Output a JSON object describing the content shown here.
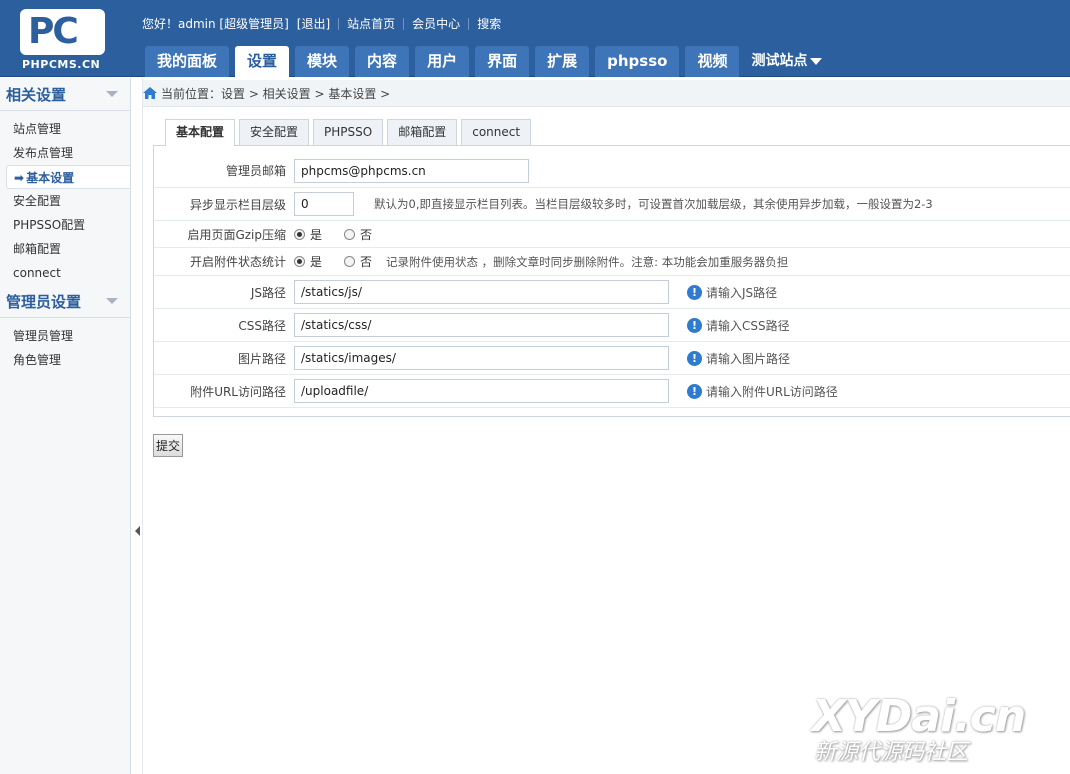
{
  "logo": {
    "mark": "PC",
    "text": "PHPCMS.CN"
  },
  "toplinks": {
    "greeting": "您好！admin [超级管理员]",
    "logout": "[退出]",
    "site_home": "站点首页",
    "member_center": "会员中心",
    "search": "搜索"
  },
  "nav": {
    "tabs": [
      "我的面板",
      "设置",
      "模块",
      "内容",
      "用户",
      "界面",
      "扩展",
      "phpsso",
      "视频"
    ],
    "active_index": 1,
    "site_selector": "测试站点"
  },
  "sidebar": {
    "group1": {
      "title": "相关设置",
      "items": [
        "站点管理",
        "发布点管理",
        "基本设置",
        "安全配置",
        "PHPSSO配置",
        "邮箱配置",
        "connect"
      ]
    },
    "group2": {
      "title": "管理员设置",
      "items": [
        "管理员管理",
        "角色管理"
      ]
    },
    "active_item": "基本设置"
  },
  "breadcrumb": "当前位置：设置 > 相关设置 > 基本设置 >",
  "subtabs": [
    "基本配置",
    "安全配置",
    "PHPSSO",
    "邮箱配置",
    "connect"
  ],
  "form": {
    "admin_email": {
      "label": "管理员邮箱",
      "value": "phpcms@phpcms.cn"
    },
    "category_level": {
      "label": "异步显示栏目层级",
      "value": "0",
      "hint": "默认为0,即直接显示栏目列表。当栏目层级较多时，可设置首次加载层级，其余使用异步加载，一般设置为2-3"
    },
    "gzip": {
      "label": "启用页面Gzip压缩",
      "yes": "是",
      "no": "否",
      "selected": "yes"
    },
    "attachment_stat": {
      "label": "开启附件状态统计",
      "yes": "是",
      "no": "否",
      "selected": "yes",
      "hint": "记录附件使用状态 ，删除文章时同步删除附件。注意: 本功能会加重服务器负担"
    },
    "js_path": {
      "label": "JS路径",
      "value": "/statics/js/",
      "tip": "请输入JS路径"
    },
    "css_path": {
      "label": "CSS路径",
      "value": "/statics/css/",
      "tip": "请输入CSS路径"
    },
    "img_path": {
      "label": "图片路径",
      "value": "/statics/images/",
      "tip": "请输入图片路径"
    },
    "upload_url": {
      "label": "附件URL访问路径",
      "value": "/uploadfile/",
      "tip": "请输入附件URL访问路径"
    }
  },
  "submit_label": "提交",
  "watermark": {
    "line1": "XYDai.cn",
    "line2": "新源代源码社区"
  },
  "colors": {
    "header": "#2c5f9e",
    "info_icon": "#2f7bd0"
  }
}
